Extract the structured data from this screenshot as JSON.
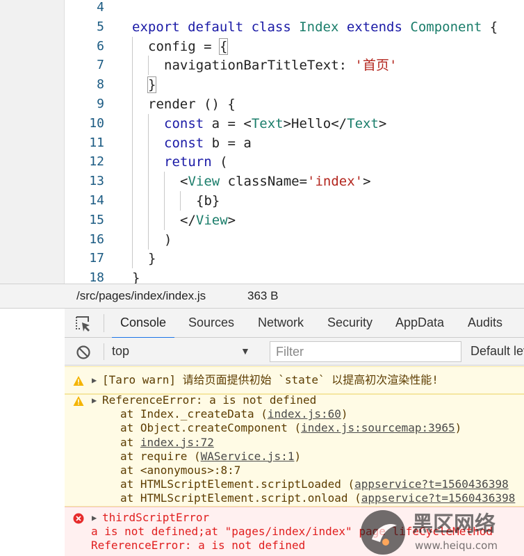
{
  "editor": {
    "lines": [
      {
        "num": "4",
        "indent": 0,
        "tokens": []
      },
      {
        "num": "5",
        "indent": 0,
        "tokens": [
          {
            "t": "export default class ",
            "c": "kw"
          },
          {
            "t": "Index ",
            "c": "cls"
          },
          {
            "t": "extends ",
            "c": "kw"
          },
          {
            "t": "Component ",
            "c": "cls"
          },
          {
            "t": "{",
            "c": ""
          }
        ]
      },
      {
        "num": "6",
        "indent": 1,
        "tokens": [
          {
            "t": "config = ",
            "c": ""
          },
          {
            "t": "{",
            "c": "box"
          }
        ]
      },
      {
        "num": "7",
        "indent": 2,
        "tokens": [
          {
            "t": "navigationBarTitleText: ",
            "c": ""
          },
          {
            "t": "'首页'",
            "c": "str"
          }
        ]
      },
      {
        "num": "8",
        "indent": 1,
        "tokens": [
          {
            "t": "}",
            "c": "box"
          }
        ]
      },
      {
        "num": "9",
        "indent": 1,
        "tokens": [
          {
            "t": "render () {",
            "c": ""
          }
        ]
      },
      {
        "num": "10",
        "indent": 2,
        "tokens": [
          {
            "t": "const ",
            "c": "kw"
          },
          {
            "t": "a = <",
            "c": ""
          },
          {
            "t": "Text",
            "c": "tag"
          },
          {
            "t": ">Hello</",
            "c": ""
          },
          {
            "t": "Text",
            "c": "tag"
          },
          {
            "t": ">",
            "c": ""
          }
        ]
      },
      {
        "num": "11",
        "indent": 2,
        "tokens": [
          {
            "t": "const ",
            "c": "kw"
          },
          {
            "t": "b = a",
            "c": ""
          }
        ]
      },
      {
        "num": "12",
        "indent": 2,
        "tokens": [
          {
            "t": "return ",
            "c": "kw"
          },
          {
            "t": "(",
            "c": ""
          }
        ]
      },
      {
        "num": "13",
        "indent": 3,
        "tokens": [
          {
            "t": "<",
            "c": ""
          },
          {
            "t": "View ",
            "c": "tag"
          },
          {
            "t": "className=",
            "c": ""
          },
          {
            "t": "'index'",
            "c": "str"
          },
          {
            "t": ">",
            "c": ""
          }
        ]
      },
      {
        "num": "14",
        "indent": 4,
        "tokens": [
          {
            "t": "{b}",
            "c": ""
          }
        ]
      },
      {
        "num": "15",
        "indent": 3,
        "tokens": [
          {
            "t": "</",
            "c": ""
          },
          {
            "t": "View",
            "c": "tag"
          },
          {
            "t": ">",
            "c": ""
          }
        ]
      },
      {
        "num": "16",
        "indent": 2,
        "tokens": [
          {
            "t": ")",
            "c": ""
          }
        ]
      },
      {
        "num": "17",
        "indent": 1,
        "tokens": [
          {
            "t": "}",
            "c": ""
          }
        ]
      },
      {
        "num": "18",
        "indent": 0,
        "tokens": [
          {
            "t": "}",
            "c": ""
          }
        ]
      }
    ]
  },
  "statusbar": {
    "path": "/src/pages/index/index.js",
    "size": "363 B"
  },
  "devtools": {
    "tabs": [
      "Console",
      "Sources",
      "Network",
      "Security",
      "AppData",
      "Audits"
    ],
    "active_tab": "Console",
    "inspect_icon": "inspect-element-icon"
  },
  "toolbar": {
    "clear_icon": "block-icon",
    "context": "top",
    "context_arrow": "▼",
    "filter_placeholder": "Filter",
    "levels": "Default levels"
  },
  "console": {
    "messages": [
      {
        "level": "warn",
        "icon": "warning-icon",
        "expand": "▶",
        "lines": [
          {
            "text": "[Taro warn] 请给页面提供初始 `state` 以提高初次渲染性能!",
            "style": "head"
          }
        ]
      },
      {
        "level": "warn",
        "icon": "warning-icon",
        "expand": "▶",
        "lines": [
          {
            "text": "ReferenceError: a is not defined",
            "style": "head"
          },
          {
            "pre": "at Index._createData (",
            "link": "index.js:60",
            "post": ")",
            "style": "indent"
          },
          {
            "pre": "at Object.createComponent (",
            "link": "index.js:sourcemap:3965",
            "post": ")",
            "style": "indent"
          },
          {
            "pre": "at ",
            "link": "index.js:72",
            "post": "",
            "style": "indent"
          },
          {
            "pre": "at require (",
            "link": "WAService.js:1",
            "post": ")",
            "style": "indent"
          },
          {
            "pre": "at <anonymous>:8:7",
            "link": "",
            "post": "",
            "style": "indent"
          },
          {
            "pre": "at HTMLScriptElement.scriptLoaded (",
            "link": "appservice?t=1560436398",
            "post": "",
            "style": "indent"
          },
          {
            "pre": "at HTMLScriptElement.script.onload (",
            "link": "appservice?t=1560436398",
            "post": "",
            "style": "indent"
          }
        ]
      },
      {
        "level": "error",
        "icon": "error-icon",
        "expand": "▶",
        "lines": [
          {
            "text": "thirdScriptError",
            "style": "head"
          },
          {
            "text": "a is not defined;at \"pages/index/index\" page lifeCycleMethod",
            "style": "plain"
          },
          {
            "text": "ReferenceError: a is not defined",
            "style": "plain"
          }
        ]
      }
    ]
  },
  "watermark": {
    "text": "黑区网络",
    "subtext": "www.heiqu.com"
  },
  "colors": {
    "keyword": "#1a1aa6",
    "class": "#1a7d6a",
    "string": "#b3261e",
    "line_number": "#1a5a82",
    "warn_bg": "#fffbe5",
    "error_text": "#e01e1e",
    "active_tab_underline": "#1a73e8"
  }
}
